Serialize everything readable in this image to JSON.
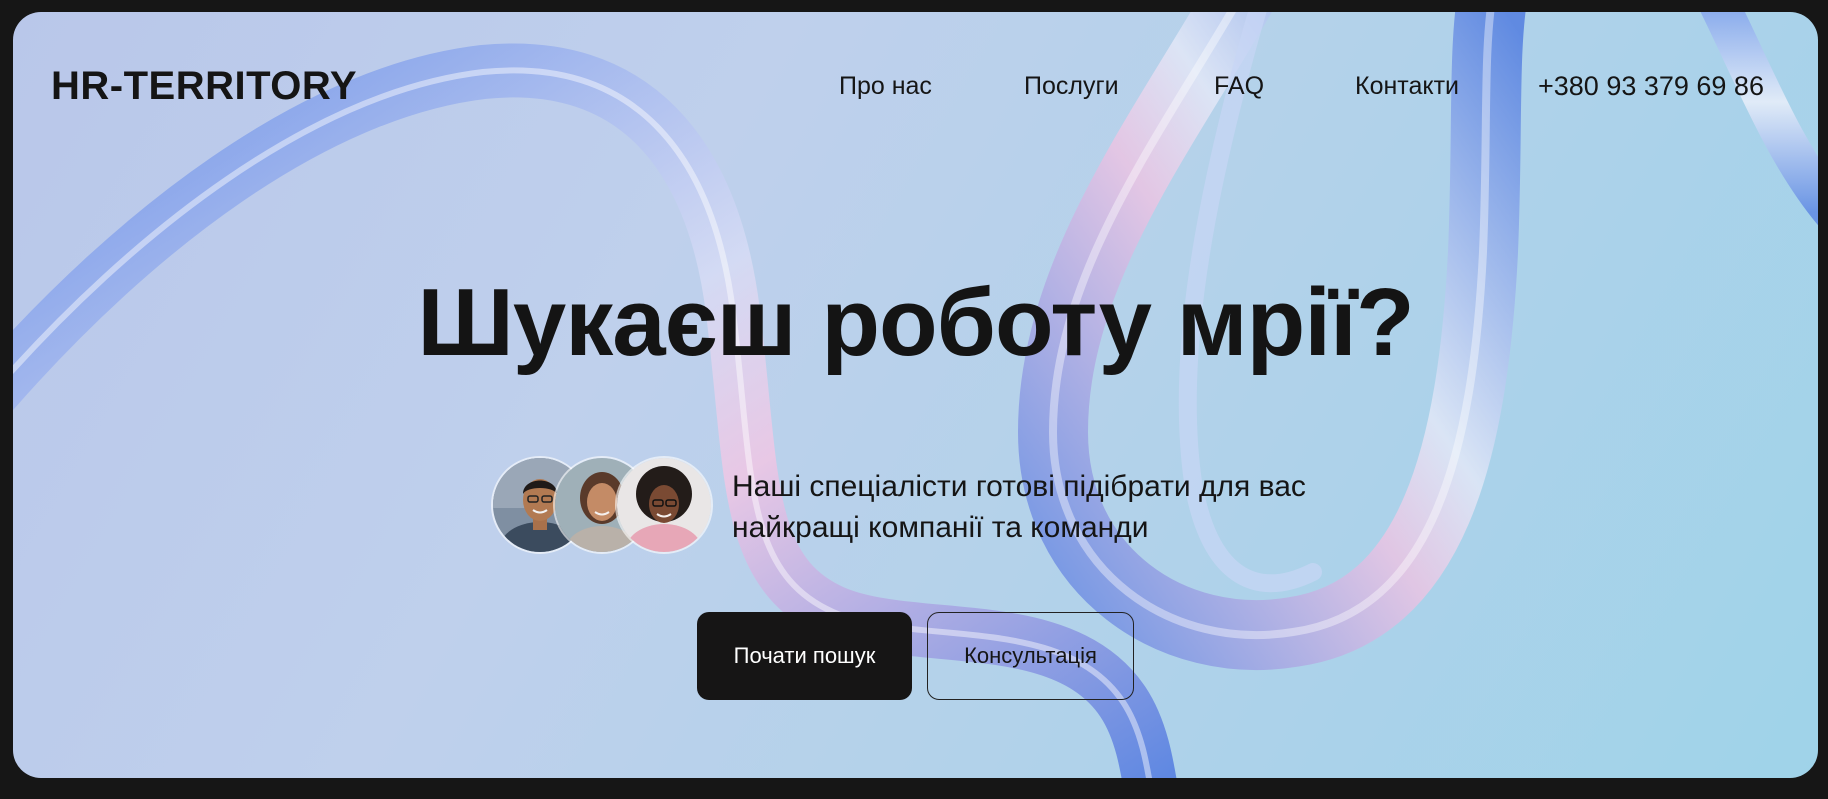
{
  "brand": {
    "logo_text": "HR-TERRITORY"
  },
  "nav": {
    "items": [
      {
        "label": "Про нас"
      },
      {
        "label": "Послуги"
      },
      {
        "label": "FAQ"
      },
      {
        "label": "Контакти"
      }
    ],
    "phone": "+380 93 379 69 86"
  },
  "hero": {
    "title": "Шукаєш роботу мрії?",
    "subtitle_line1": "Наші спеціалісти готові підібрати для вас",
    "subtitle_line2": "найкращі компанії та команди",
    "primary_button": "Почати пошук",
    "secondary_button": "Консультація"
  },
  "colors": {
    "background_frame": "#161616",
    "text": "#151515",
    "primary_button_bg": "#161515",
    "primary_button_text": "#ffffff"
  },
  "icons": [
    "avatar-photo",
    "avatar-photo",
    "avatar-photo"
  ]
}
